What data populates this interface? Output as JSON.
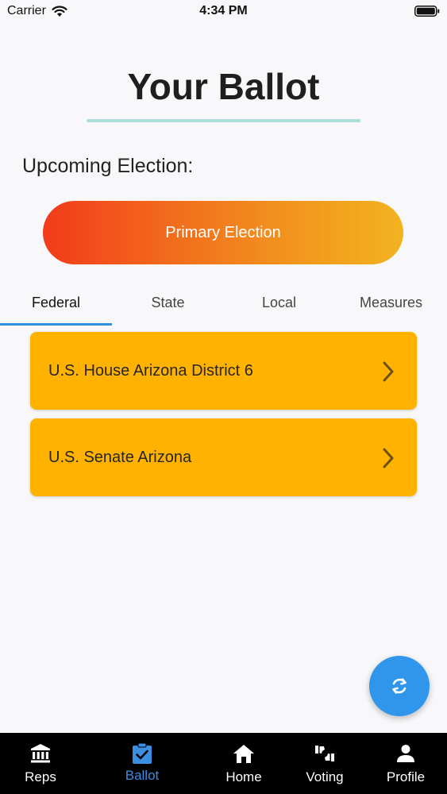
{
  "status_bar": {
    "carrier": "Carrier",
    "time": "4:34 PM"
  },
  "page": {
    "title": "Your Ballot",
    "upcoming_label": "Upcoming Election:"
  },
  "election": {
    "name": "Primary Election"
  },
  "tabs": [
    {
      "label": "Federal",
      "active": true
    },
    {
      "label": "State",
      "active": false
    },
    {
      "label": "Local",
      "active": false
    },
    {
      "label": "Measures",
      "active": false
    }
  ],
  "races": [
    {
      "label": "U.S. House Arizona District 6"
    },
    {
      "label": "U.S. Senate Arizona"
    }
  ],
  "fab": {
    "icon": "refresh-icon"
  },
  "bottom_nav": [
    {
      "label": "Reps",
      "icon": "bank-icon"
    },
    {
      "label": "Ballot",
      "icon": "ballot-clipboard-icon",
      "active": true
    },
    {
      "label": "Home",
      "icon": "home-icon"
    },
    {
      "label": "Voting",
      "icon": "thumbs-icon"
    },
    {
      "label": "Profile",
      "icon": "person-icon"
    }
  ],
  "colors": {
    "accent": "#2f96ec",
    "card": "#ffb300",
    "gradient_start": "#f23a1b",
    "gradient_end": "#f2b320",
    "underline": "#a9dfd6"
  }
}
